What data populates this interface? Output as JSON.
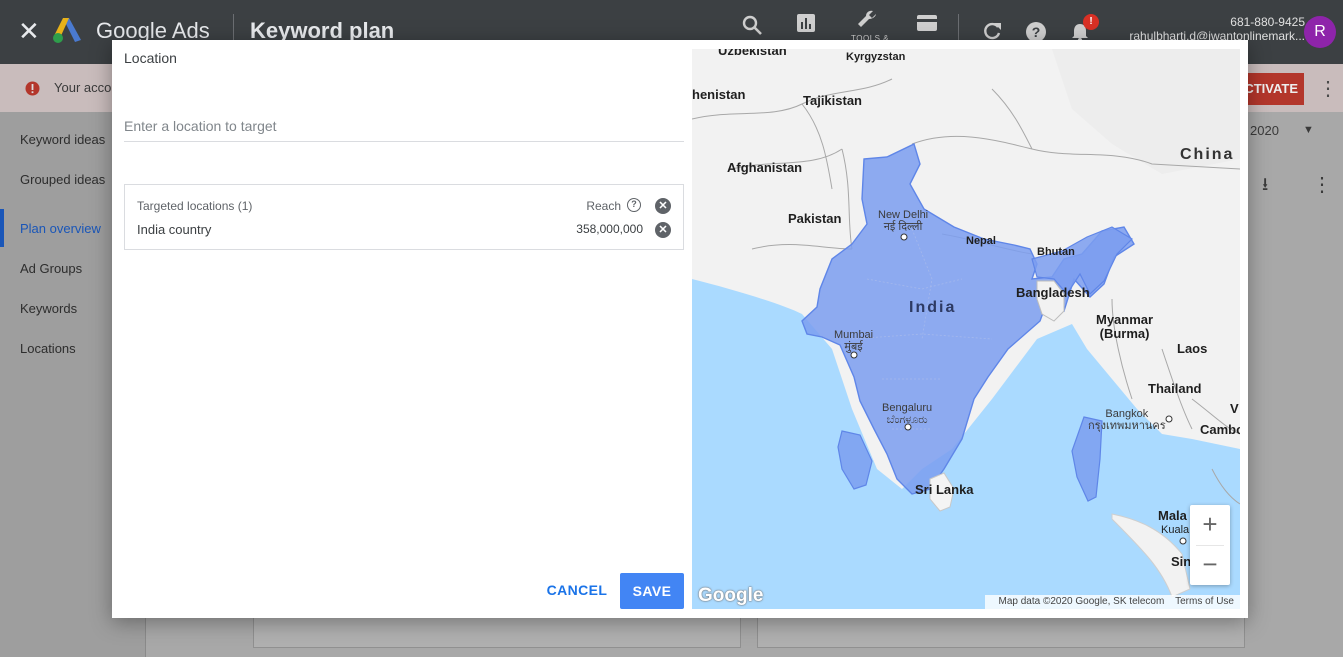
{
  "topbar": {
    "brand": "Google Ads",
    "page_title": "Keyword plan",
    "tools_label": "TOOLS &",
    "notification_count": "!",
    "phone": "681-880-9425",
    "email": "rahulbharti.d@iwantonlinemark...",
    "avatar_letter": "R"
  },
  "alert": {
    "text": "Your acco",
    "action": "CTIVATE"
  },
  "sidebar": {
    "items": [
      {
        "label": "Keyword ideas"
      },
      {
        "label": "Grouped ideas"
      },
      {
        "label": "Plan overview"
      },
      {
        "label": "Ad Groups"
      },
      {
        "label": "Keywords"
      },
      {
        "label": "Locations"
      }
    ],
    "active_index": 2
  },
  "date_range": "2020",
  "dialog": {
    "title": "Location",
    "search_placeholder": "Enter a location to target",
    "targeted_header": "Targeted locations (1)",
    "reach_label": "Reach",
    "locations": [
      {
        "name": "India country",
        "reach": "358,000,000"
      }
    ],
    "cancel_label": "CANCEL",
    "save_label": "SAVE"
  },
  "map": {
    "labels": {
      "uzbekistan": "Uzbekistan",
      "kyrgyzstan": "Kyrgyzstan",
      "turkmenistan": "henistan",
      "tajikistan": "Tajikistan",
      "afghanistan": "Afghanistan",
      "china": "China",
      "pakistan": "Pakistan",
      "new_delhi": "New Delhi",
      "new_delhi_native": "नई दिल्ली",
      "nepal": "Nepal",
      "bhutan": "Bhutan",
      "india": "India",
      "bangladesh": "Bangladesh",
      "myanmar": "Myanmar",
      "burma": "(Burma)",
      "mumbai": "Mumbai",
      "mumbai_native": "मुंबई",
      "laos": "Laos",
      "thailand": "Thailand",
      "bangkok": "Bangkok",
      "bangkok_native": "กรุงเทพมหานคร",
      "cambodia": "Cambod",
      "vietnam": "V",
      "bengaluru": "Bengaluru",
      "bengaluru_native": "ಬೆಂಗಳೂರು",
      "sri_lanka": "Sri Lanka",
      "malaysia": "Mala",
      "kuala_lumpur": "Kuala Lu",
      "singapore": "Sin"
    },
    "zoom_in": "+",
    "zoom_out": "−",
    "logo": "Google",
    "attribution": "Map data ©2020 Google, SK telecom",
    "terms": "Terms of Use"
  },
  "colors": {
    "accent": "#4285f4",
    "highlight_fill": "#7b9ef0",
    "water": "#aadaff"
  }
}
